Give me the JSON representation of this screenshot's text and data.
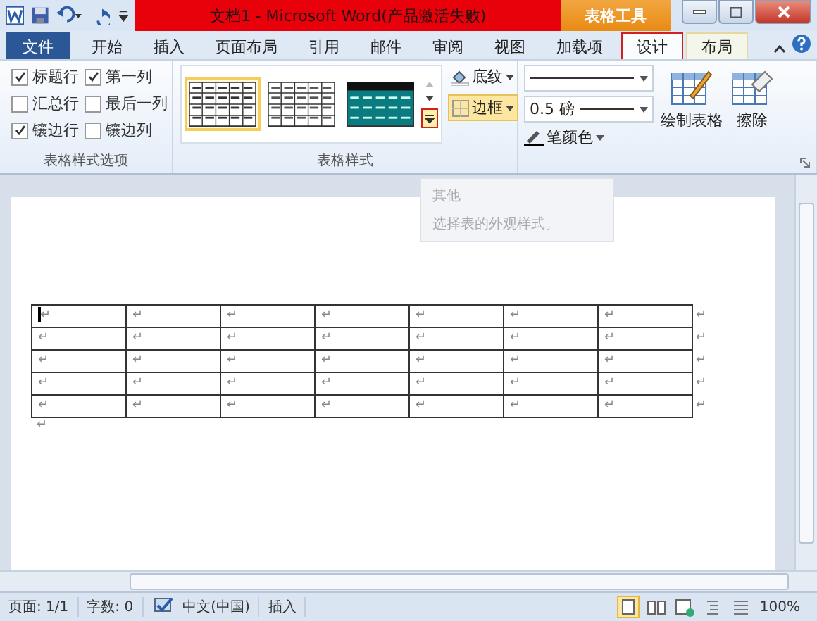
{
  "window": {
    "title": "文档1 - Microsoft Word(产品激活失败)",
    "context_tab_group": "表格工具"
  },
  "tabs": [
    {
      "label": "文件",
      "kind": "file",
      "selected": false
    },
    {
      "label": "开始",
      "kind": "normal",
      "selected": false
    },
    {
      "label": "插入",
      "kind": "normal",
      "selected": false
    },
    {
      "label": "页面布局",
      "kind": "normal",
      "selected": false
    },
    {
      "label": "引用",
      "kind": "normal",
      "selected": false
    },
    {
      "label": "邮件",
      "kind": "normal",
      "selected": false
    },
    {
      "label": "审阅",
      "kind": "normal",
      "selected": false
    },
    {
      "label": "视图",
      "kind": "normal",
      "selected": false
    },
    {
      "label": "加载项",
      "kind": "normal",
      "selected": false
    },
    {
      "label": "设计",
      "kind": "context",
      "selected": true
    },
    {
      "label": "布局",
      "kind": "context",
      "selected": false
    }
  ],
  "style_options": {
    "label": "表格样式选项",
    "checkboxes": [
      {
        "label": "标题行",
        "checked": true
      },
      {
        "label": "第一列",
        "checked": true
      },
      {
        "label": "汇总行",
        "checked": false
      },
      {
        "label": "最后一列",
        "checked": false
      },
      {
        "label": "镶边行",
        "checked": true
      },
      {
        "label": "镶边列",
        "checked": false
      }
    ]
  },
  "table_styles": {
    "label": "表格样式",
    "styles": [
      {
        "kind": "plain",
        "selected": true
      },
      {
        "kind": "grid",
        "selected": false
      },
      {
        "kind": "teal",
        "selected": false
      }
    ],
    "shading": "底纹",
    "borders": "边框"
  },
  "draw_borders": {
    "line_weight": "0.5 磅",
    "pen_color": "笔颜色",
    "draw_table": "绘制表格",
    "eraser": "擦除"
  },
  "tooltip": {
    "title": "其他",
    "text": "选择表的外观样式。"
  },
  "table": {
    "rows": [
      {
        "cells": [
          "↵",
          "↵",
          "↵",
          "↵",
          "↵",
          "↵",
          "↵"
        ],
        "end_mark": "↵"
      },
      {
        "cells": [
          "↵",
          "↵",
          "↵",
          "↵",
          "↵",
          "↵",
          "↵"
        ],
        "end_mark": "↵"
      },
      {
        "cells": [
          "↵",
          "↵",
          "↵",
          "↵",
          "↵",
          "↵",
          "↵"
        ],
        "end_mark": "↵"
      },
      {
        "cells": [
          "↵",
          "↵",
          "↵",
          "↵",
          "↵",
          "↵",
          "↵"
        ],
        "end_mark": "↵"
      },
      {
        "cells": [
          "↵",
          "↵",
          "↵",
          "↵",
          "↵",
          "↵",
          "↵"
        ],
        "end_mark": "↵"
      }
    ],
    "after_mark": "↵"
  },
  "status_bar": {
    "page": "页面: 1/1",
    "words": "字数: 0",
    "language": "中文(中国)",
    "mode": "插入",
    "zoom": "100%"
  }
}
